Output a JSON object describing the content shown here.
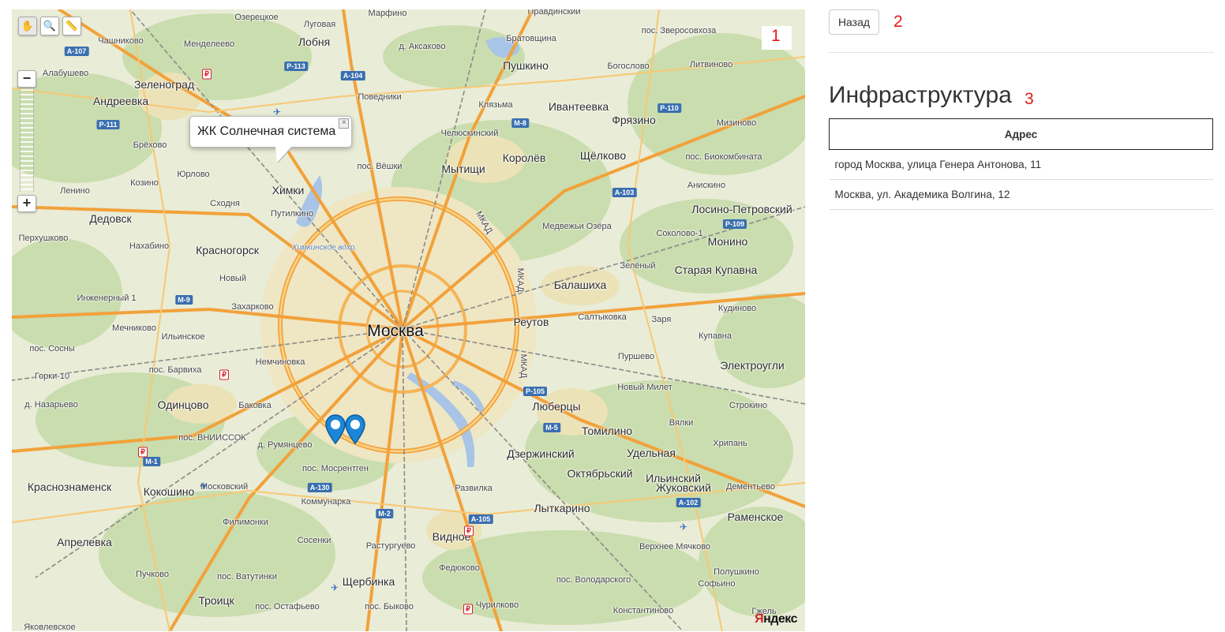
{
  "map": {
    "balloon_text": "ЖК Солнечная система",
    "logo": "Яндекс",
    "tools": [
      "hand-icon",
      "magnifier-icon",
      "ruler-icon"
    ],
    "zoom_in": "+",
    "zoom_out": "−",
    "city_labels": [
      "Москва",
      "Зеленоград",
      "Андреевка",
      "Химки",
      "Лобня",
      "Пушкино",
      "Ивантеевка",
      "Фрязино",
      "Королёв",
      "Мытищи",
      "Щёлково",
      "Дедовск",
      "Красногорск",
      "Балашиха",
      "Старая Купавна",
      "Монино",
      "Лосино-Петровский",
      "Реутов",
      "Электроугли",
      "Люберцы",
      "Томилино",
      "Одинцово",
      "Кокошино",
      "Краснознаменск",
      "Апрелевка",
      "Видное",
      "Дзержинский",
      "Октябрьский",
      "Лыткарино",
      "Жуковский",
      "Раменское",
      "Щербинка",
      "Троицк",
      "Удельная",
      "Ильинский"
    ],
    "place_labels": [
      "Чашниково",
      "Менделеево",
      "Луговая",
      "Марфино",
      "Правдинский",
      "Озерецкое",
      "пос. Зверосовхоза",
      "Алабушево",
      "д. Аксаково",
      "Братовщина",
      "Богослово",
      "Литвиново",
      "Поведники",
      "Клязьма",
      "Челюскинский",
      "пос. Вёшки",
      "Брёхово",
      "Юрлово",
      "Козино",
      "Ленино",
      "Сходня",
      "Путилкино",
      "Нахабино",
      "Перхушково",
      "Новый",
      "Захарково",
      "Инженерный 1",
      "Мечниково",
      "Ильинское",
      "пос. Сосны",
      "Горки-10",
      "пос. Барвиха",
      "Немчиновка",
      "Баковка",
      "д. Румянцево",
      "пос. Мосрентген",
      "Московский",
      "пос. ВНИИССОК",
      "Филимонки",
      "Сосенки",
      "Коммунарка",
      "Растургуево",
      "Федюково",
      "пос. Ватутинки",
      "Пучково",
      "пос. Остафьево",
      "пос. Быково",
      "Чурилково",
      "Константиново",
      "Верхнее Мячково",
      "Софьино",
      "Гжель",
      "Кудиново",
      "Купавна",
      "Пуршево",
      "Новый Милет",
      "Строкино",
      "Вялки",
      "Хрипань",
      "Дементьево",
      "Зелёный",
      "Салтыковка",
      "Заря",
      "Соколово-1",
      "Медвежьи Озёра",
      "Анискино",
      "пос. Биокомбината",
      "Мизиново",
      "Развилка",
      "пос. Володарского",
      "Полушкино",
      "Яковлевское",
      "д. Назарьево"
    ],
    "road_shields": [
      "А-107",
      "Р-113",
      "А-104",
      "М-8",
      "Р-110",
      "Р-111",
      "А-103",
      "Р-109",
      "М-9",
      "М-1",
      "А-130",
      "М-2",
      "А-105",
      "М-5",
      "Р-105",
      "А-102"
    ],
    "ring_labels": [
      "МКАД",
      "МКАД",
      "МКАД"
    ],
    "water_labels": [
      "Химкинское вдхр."
    ]
  },
  "panel": {
    "back_button": "Назад",
    "heading": "Инфраструктура",
    "table": {
      "column_header": "Адрес",
      "rows": [
        "город Москва, улица Генера Антонова, 11",
        "Москва, ул. Академика Волгина, 12"
      ]
    }
  },
  "annotations": [
    "1",
    "2",
    "3"
  ]
}
